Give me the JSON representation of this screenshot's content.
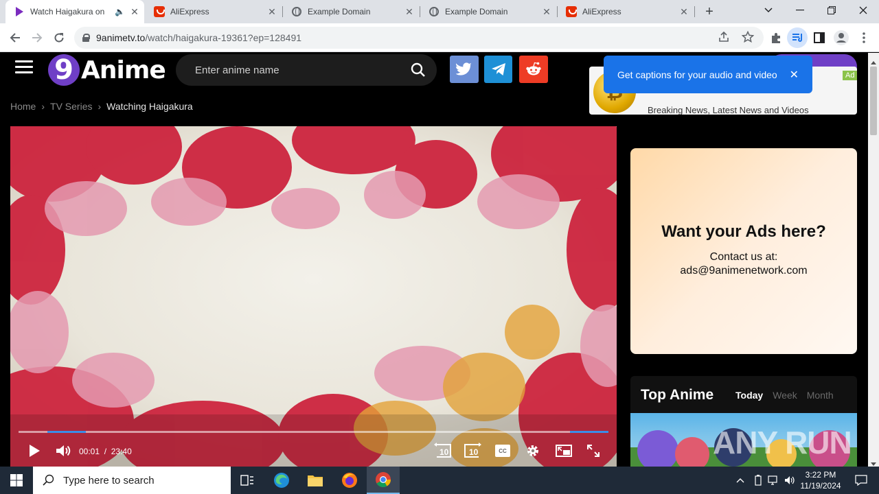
{
  "browser": {
    "tabs": [
      {
        "title": "Watch Haigakura on",
        "icon": "play-icon",
        "active": true,
        "audio": true
      },
      {
        "title": "AliExpress",
        "icon": "aliexpress-icon"
      },
      {
        "title": "Example Domain",
        "icon": "globe-icon"
      },
      {
        "title": "Example Domain",
        "icon": "globe-icon"
      },
      {
        "title": "AliExpress",
        "icon": "aliexpress-icon"
      }
    ],
    "url_domain": "9animetv.to",
    "url_path": "/watch/haigakura-19361?ep=128491"
  },
  "site": {
    "logo_nine": "9",
    "logo_word": "Anime",
    "search_placeholder": "Enter anime name",
    "breadcrumb": [
      "Home",
      "TV Series",
      "Watching Haigakura"
    ]
  },
  "player": {
    "current_time": "00:01",
    "separator": "/",
    "duration": "23:40",
    "progress": 0.0007,
    "rewind_label": "10",
    "forward_label": "10",
    "cc_label": "CC"
  },
  "captions_popup": {
    "message": "Get captions for your audio and video",
    "close": "✕"
  },
  "ad_banner": {
    "text": "Breaking News, Latest News and Videos",
    "badge": "Ad"
  },
  "ad_box": {
    "heading": "Want your Ads here?",
    "line1": "Contact us at:",
    "line2": "ads@9animenetwork.com"
  },
  "top_anime": {
    "title": "Top Anime",
    "tabs": [
      "Today",
      "Week",
      "Month"
    ],
    "thumb_watermark": "ANY RUN"
  },
  "taskbar": {
    "search_placeholder": "Type here to search",
    "time": "3:22 PM",
    "date": "11/19/2024"
  },
  "colors": {
    "accent_purple": "#6f3fc6",
    "twitter": "#6c8fd6",
    "telegram": "#1e90d6",
    "reddit": "#ee3c25",
    "caption_blue": "#1a73e8",
    "progress_blue": "#3a8de8"
  }
}
